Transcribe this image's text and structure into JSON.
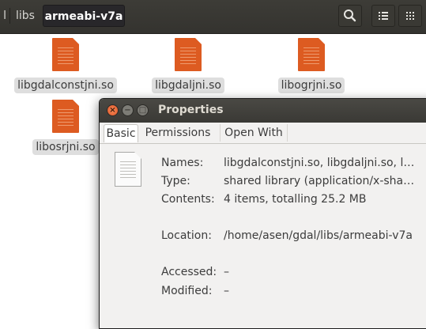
{
  "header": {
    "crumbs": [
      "l",
      "libs",
      "armeabi-v7a"
    ],
    "icons": [
      "search-icon",
      "list-view-icon",
      "grid-view-icon"
    ]
  },
  "files": [
    {
      "name": "libgdalconstjni.so"
    },
    {
      "name": "libgdaljni.so"
    },
    {
      "name": "libogrjni.so"
    },
    {
      "name": "libosrjni.so"
    }
  ],
  "dialog": {
    "title": "Properties",
    "controls": [
      "×",
      "−",
      "□"
    ],
    "tabs": [
      "Basic",
      "Permissions",
      "Open With"
    ],
    "rows": [
      {
        "label": "Names:",
        "value": "libgdalconstjni.so, libgdaljni.so, l…"
      },
      {
        "label": "Type:",
        "value": "shared library (application/x-sha…"
      },
      {
        "label": "Contents:",
        "value": "4 items, totalling 25.2 MB"
      },
      {
        "label": "Location:",
        "value": "/home/asen/gdal/libs/armeabi-v7a"
      },
      {
        "label": "Accessed:",
        "value": "–"
      },
      {
        "label": "Modified:",
        "value": "–"
      }
    ]
  },
  "colors": {
    "header_bg": "#3d3c37",
    "file_icon": "#dd5b21",
    "close_button": "#e0552a",
    "dialog_bg": "#f2f1f0"
  }
}
